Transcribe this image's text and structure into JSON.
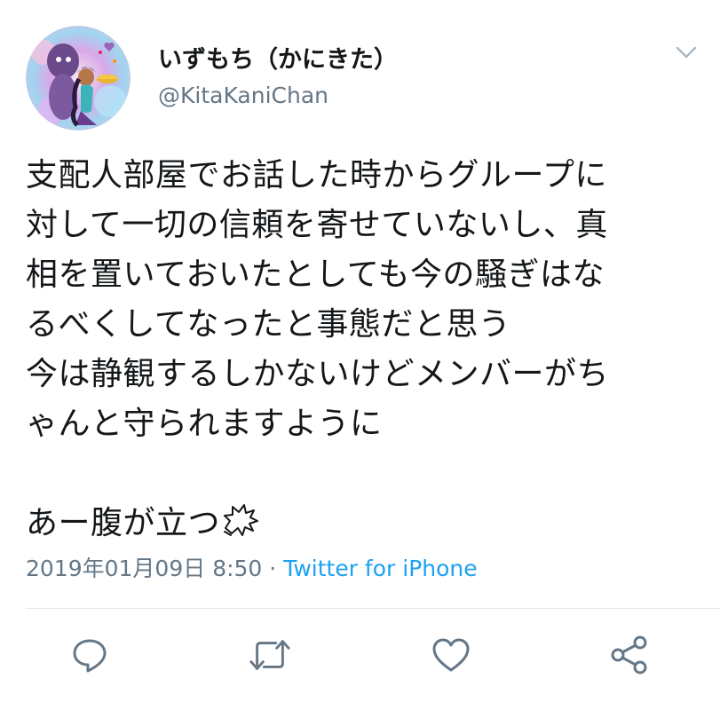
{
  "tweet": {
    "display_name": "いずもち（かにきた）",
    "handle": "@KitaKaniChan",
    "lines": [
      "支配人部屋でお話した時からグループに",
      "対して一切の信頼を寄せていないし、真",
      "相を置いておいたとしても今の騒ぎはな",
      "るべくしてなったと事態だと思う",
      "今は静観するしかないけどメンバーがち",
      "ゃんと守られますように",
      "",
      "あー腹が立つ"
    ],
    "timestamp": "2019年01月09日 8:50",
    "separator": " · ",
    "source": "Twitter for iPhone"
  },
  "icons": {
    "avatar": "avatar-illustration",
    "menu": "chevron-down-icon",
    "anger": "anger-symbol-icon",
    "reply": "reply-icon",
    "retweet": "retweet-icon",
    "like": "heart-icon",
    "share": "share-icon"
  },
  "colors": {
    "text": "#14171a",
    "secondary": "#657786",
    "link": "#1da1f2",
    "divider": "#e1e8ed"
  }
}
